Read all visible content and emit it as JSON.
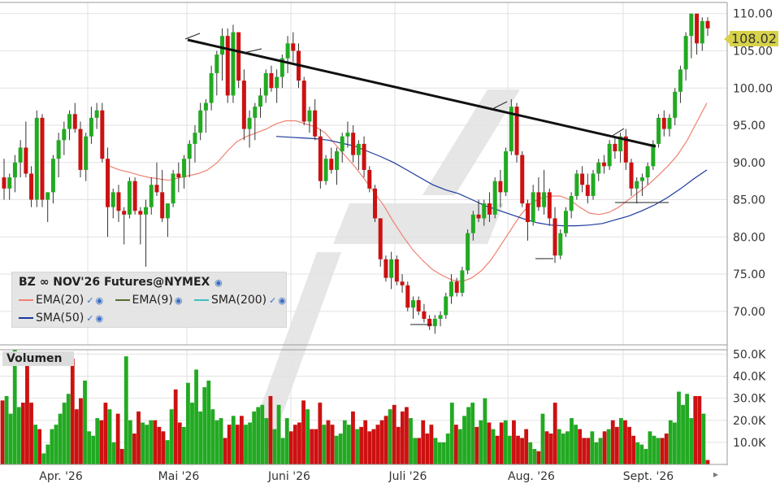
{
  "legend": {
    "title": "BZ ∞ NOV'26 Futures@NYMEX",
    "items": [
      {
        "name": "EMA(20)",
        "color": "#f08070"
      },
      {
        "name": "EMA(9)",
        "color": "#556b2f"
      },
      {
        "name": "SMA(200)",
        "color": "#40c0c0"
      },
      {
        "name": "SMA(50)",
        "color": "#1a3a9c"
      }
    ]
  },
  "volume_label": "Volumen",
  "last_price": "108.02",
  "chart_data": [
    {
      "type": "candlestick",
      "title": "BZ ∞ NOV'26 Futures@NYMEX",
      "y_ticks": [
        "70.00",
        "75.00",
        "80.00",
        "85.00",
        "90.00",
        "95.00",
        "100.00",
        "105.00",
        "110.00"
      ],
      "ylim": [
        65.5,
        111.5
      ],
      "x_tick_labels": [
        "Apr. '26",
        "Mai '26",
        "Juni '26",
        "Juli '26",
        "Aug. '26",
        "Sept. '26"
      ],
      "grid": true,
      "colors": {
        "up": "#22aa22",
        "down": "#cc1111"
      },
      "candles": [
        [
          88.0,
          90.5,
          85.0,
          86.5
        ],
        [
          86.5,
          88.5,
          85.0,
          88.0
        ],
        [
          88.0,
          91.0,
          86.0,
          90.0
        ],
        [
          90.0,
          93.0,
          88.0,
          92.0
        ],
        [
          92.0,
          95.5,
          88.0,
          88.5
        ],
        [
          88.5,
          89.5,
          84.0,
          85.0
        ],
        [
          85.0,
          97.0,
          84.0,
          96.0
        ],
        [
          96.0,
          96.5,
          84.0,
          85.0
        ],
        [
          85.0,
          86.0,
          82.0,
          86.0
        ],
        [
          86.0,
          91.0,
          84.5,
          90.5
        ],
        [
          90.5,
          94.0,
          88.0,
          93.0
        ],
        [
          93.0,
          95.5,
          91.0,
          94.5
        ],
        [
          94.5,
          97.0,
          93.0,
          96.5
        ],
        [
          96.5,
          98.0,
          94.0,
          94.5
        ],
        [
          94.5,
          95.5,
          88.0,
          89.0
        ],
        [
          89.0,
          94.0,
          87.5,
          93.5
        ],
        [
          93.5,
          97.5,
          92.5,
          96.0
        ],
        [
          96.0,
          98.0,
          94.5,
          97.0
        ],
        [
          97.0,
          98.0,
          90.0,
          90.5
        ],
        [
          90.5,
          92.0,
          80.0,
          84.0
        ],
        [
          84.0,
          86.5,
          82.5,
          86.0
        ],
        [
          86.0,
          87.0,
          82.0,
          83.5
        ],
        [
          83.5,
          84.0,
          79.0,
          83.0
        ],
        [
          83.0,
          88.0,
          82.5,
          87.5
        ],
        [
          87.5,
          88.0,
          83.0,
          83.5
        ],
        [
          83.5,
          84.0,
          79.0,
          83.0
        ],
        [
          83.0,
          85.0,
          76.0,
          84.0
        ],
        [
          84.0,
          88.0,
          83.0,
          87.0
        ],
        [
          87.0,
          90.0,
          85.5,
          86.0
        ],
        [
          86.0,
          89.0,
          82.0,
          82.5
        ],
        [
          82.5,
          84.0,
          80.0,
          84.5
        ],
        [
          84.5,
          89.0,
          84.0,
          88.5
        ],
        [
          88.5,
          90.0,
          86.0,
          88.0
        ],
        [
          88.0,
          91.0,
          86.5,
          90.5
        ],
        [
          90.5,
          93.0,
          88.0,
          92.5
        ],
        [
          92.5,
          95.0,
          90.0,
          94.0
        ],
        [
          94.0,
          98.0,
          93.0,
          97.0
        ],
        [
          97.0,
          98.5,
          94.0,
          98.0
        ],
        [
          98.0,
          103.0,
          97.0,
          102.0
        ],
        [
          102.0,
          105.0,
          99.0,
          104.5
        ],
        [
          104.5,
          108.0,
          101.0,
          107.0
        ],
        [
          107.0,
          108.0,
          98.0,
          99.0
        ],
        [
          99.0,
          108.5,
          98.0,
          107.5
        ],
        [
          107.5,
          107.5,
          100.0,
          101.0
        ],
        [
          101.0,
          102.5,
          93.0,
          94.5
        ],
        [
          94.5,
          97.0,
          92.0,
          96.0
        ],
        [
          96.0,
          98.0,
          93.0,
          97.5
        ],
        [
          97.5,
          100.0,
          96.0,
          99.0
        ],
        [
          99.0,
          102.5,
          98.0,
          102.0
        ],
        [
          102.0,
          103.0,
          99.5,
          100.0
        ],
        [
          100.0,
          102.5,
          98.0,
          101.5
        ],
        [
          101.5,
          104.5,
          100.0,
          104.0
        ],
        [
          104.0,
          107.0,
          102.0,
          106.0
        ],
        [
          106.0,
          107.5,
          103.5,
          105.0
        ],
        [
          105.0,
          106.0,
          100.0,
          101.0
        ],
        [
          101.0,
          101.5,
          95.0,
          95.5
        ],
        [
          95.5,
          97.5,
          94.0,
          97.0
        ],
        [
          97.0,
          98.5,
          93.0,
          93.5
        ],
        [
          93.5,
          94.5,
          86.5,
          87.5
        ],
        [
          87.5,
          91.0,
          87.0,
          90.5
        ],
        [
          90.5,
          92.0,
          88.5,
          89.0
        ],
        [
          89.0,
          92.0,
          87.0,
          91.5
        ],
        [
          91.5,
          94.0,
          90.0,
          93.5
        ],
        [
          93.5,
          95.5,
          92.0,
          94.0
        ],
        [
          94.0,
          95.0,
          90.0,
          91.0
        ],
        [
          91.0,
          93.0,
          89.0,
          92.5
        ],
        [
          92.5,
          93.5,
          88.0,
          89.0
        ],
        [
          89.0,
          89.5,
          86.0,
          86.5
        ],
        [
          86.5,
          87.0,
          82.0,
          82.5
        ],
        [
          82.5,
          82.5,
          76.0,
          77.0
        ],
        [
          77.0,
          77.5,
          74.0,
          74.5
        ],
        [
          74.5,
          78.0,
          73.0,
          77.0
        ],
        [
          77.0,
          77.5,
          73.5,
          74.0
        ],
        [
          74.0,
          75.0,
          72.5,
          73.5
        ],
        [
          73.5,
          74.0,
          70.0,
          70.5
        ],
        [
          70.5,
          72.0,
          69.0,
          71.5
        ],
        [
          71.5,
          72.0,
          69.5,
          70.0
        ],
        [
          70.0,
          71.0,
          68.5,
          69.0
        ],
        [
          69.0,
          69.5,
          67.5,
          68.0
        ],
        [
          68.0,
          69.5,
          67.0,
          69.0
        ],
        [
          69.0,
          70.0,
          68.0,
          69.5
        ],
        [
          69.5,
          72.5,
          69.0,
          72.0
        ],
        [
          72.0,
          75.0,
          71.0,
          74.0
        ],
        [
          74.0,
          74.5,
          72.0,
          72.5
        ],
        [
          72.5,
          76.0,
          72.0,
          75.5
        ],
        [
          75.5,
          81.0,
          75.0,
          80.5
        ],
        [
          80.5,
          83.5,
          79.5,
          83.0
        ],
        [
          83.0,
          85.0,
          82.0,
          82.5
        ],
        [
          82.5,
          85.0,
          81.5,
          84.5
        ],
        [
          84.5,
          86.0,
          82.0,
          83.0
        ],
        [
          83.0,
          88.0,
          82.5,
          87.5
        ],
        [
          87.5,
          89.0,
          84.0,
          86.0
        ],
        [
          86.0,
          92.0,
          85.5,
          91.5
        ],
        [
          91.5,
          98.5,
          91.0,
          97.5
        ],
        [
          97.5,
          98.0,
          90.0,
          91.0
        ],
        [
          91.0,
          91.5,
          84.0,
          84.5
        ],
        [
          84.5,
          85.0,
          79.5,
          82.0
        ],
        [
          82.0,
          87.0,
          81.5,
          86.0
        ],
        [
          86.0,
          88.0,
          83.5,
          84.0
        ],
        [
          84.0,
          89.0,
          83.0,
          86.0
        ],
        [
          86.0,
          86.5,
          81.5,
          82.5
        ],
        [
          82.5,
          84.0,
          76.5,
          77.5
        ],
        [
          77.5,
          81.0,
          77.0,
          80.5
        ],
        [
          80.5,
          84.0,
          80.0,
          83.5
        ],
        [
          83.5,
          86.0,
          82.5,
          85.5
        ],
        [
          85.5,
          89.0,
          85.0,
          88.5
        ],
        [
          88.5,
          89.5,
          86.0,
          87.0
        ],
        [
          87.0,
          88.5,
          84.5,
          85.5
        ],
        [
          85.5,
          89.0,
          85.0,
          88.5
        ],
        [
          88.5,
          90.5,
          87.5,
          90.0
        ],
        [
          90.0,
          91.0,
          88.5,
          89.5
        ],
        [
          89.5,
          93.0,
          89.0,
          92.5
        ],
        [
          92.5,
          93.5,
          90.5,
          91.5
        ],
        [
          91.5,
          94.0,
          90.0,
          93.5
        ],
        [
          93.5,
          94.5,
          89.0,
          90.0
        ],
        [
          90.0,
          90.5,
          85.5,
          86.5
        ],
        [
          86.5,
          88.0,
          84.5,
          87.5
        ],
        [
          87.5,
          88.5,
          85.5,
          88.0
        ],
        [
          88.0,
          90.0,
          87.0,
          89.5
        ],
        [
          89.5,
          93.0,
          89.0,
          92.5
        ],
        [
          92.5,
          96.5,
          92.0,
          96.0
        ],
        [
          96.0,
          97.0,
          93.5,
          94.5
        ],
        [
          94.5,
          96.5,
          93.5,
          96.0
        ],
        [
          96.0,
          100.0,
          95.0,
          99.5
        ],
        [
          99.5,
          103.0,
          98.0,
          102.5
        ],
        [
          102.5,
          107.5,
          101.0,
          107.0
        ],
        [
          107.0,
          110.0,
          104.0,
          110.0
        ],
        [
          110.0,
          110.0,
          104.5,
          106.0
        ],
        [
          106.0,
          109.5,
          105.0,
          109.0
        ],
        [
          109.0,
          109.5,
          107.0,
          108.02
        ]
      ],
      "ema20": [
        89.5,
        89.0,
        88.7,
        88.3,
        88.0,
        87.8,
        87.6,
        87.9,
        88.2,
        88.5,
        89.0,
        90.0,
        91.5,
        92.8,
        93.5,
        94.0,
        94.5,
        95.2,
        95.6,
        95.6,
        95.2,
        94.8,
        94.0,
        92.5,
        91.0,
        89.5,
        87.8,
        86.0,
        84.2,
        82.0,
        80.0,
        78.2,
        76.8,
        75.6,
        74.8,
        74.2,
        74.0,
        74.5,
        75.5,
        77.0,
        79.0,
        81.0,
        83.0,
        84.5,
        85.2,
        85.5,
        85.5,
        85.0,
        84.0,
        83.2,
        83.0,
        83.3,
        84.0,
        85.0,
        86.0,
        87.0,
        88.2,
        89.5,
        91.0,
        93.0,
        95.5,
        98.0
      ],
      "sma50": [
        93.5,
        93.4,
        93.3,
        93.2,
        93.0,
        92.6,
        92.2,
        91.5,
        90.8,
        90.0,
        89.0,
        88.0,
        87.0,
        86.3,
        85.8,
        85.0,
        84.2,
        83.6,
        83.0,
        82.4,
        81.9,
        81.6,
        81.5,
        81.5,
        81.6,
        81.8,
        82.3,
        82.8,
        83.5,
        84.3,
        85.3,
        86.5,
        87.8,
        89.0
      ]
    },
    {
      "type": "bar",
      "title": "Volumen",
      "y_ticks": [
        "10.0K",
        "20.0K",
        "30.0K",
        "40.0K",
        "50.0K"
      ],
      "ylim": [
        0,
        52
      ],
      "colors": {
        "up": "#22aa22",
        "down": "#cc1111"
      },
      "values": [
        29,
        31,
        23,
        52,
        26,
        28,
        49,
        28,
        18,
        16,
        5,
        9,
        16,
        18,
        23,
        28,
        32,
        48,
        25,
        30,
        38,
        15,
        13,
        21,
        20,
        28,
        25,
        10,
        23,
        7,
        49,
        20,
        14,
        24,
        19,
        18,
        20,
        20,
        17,
        15,
        11,
        25,
        34,
        19,
        17,
        37,
        28,
        43,
        24,
        35,
        38,
        25,
        20,
        21,
        12,
        18,
        22,
        18,
        22,
        18,
        19,
        24,
        26,
        27,
        21,
        31,
        16,
        27,
        12,
        21,
        15,
        18,
        19,
        29,
        25,
        16,
        16,
        28,
        18,
        20,
        18,
        13,
        14,
        20,
        18,
        24,
        16,
        17,
        20,
        15,
        16,
        18,
        20,
        22,
        25,
        27,
        17,
        24,
        26,
        21,
        12,
        12,
        20,
        14,
        18,
        12,
        10,
        10,
        14,
        28,
        18,
        16,
        22,
        26,
        28,
        17,
        20,
        30,
        19,
        16,
        13,
        19,
        20,
        13,
        20,
        13,
        12,
        16,
        10,
        7,
        6,
        23,
        15,
        14,
        28,
        16,
        14,
        15,
        21,
        18,
        16,
        12,
        12,
        15,
        10,
        12,
        15,
        16,
        20,
        17,
        21,
        20,
        17,
        13,
        10,
        9,
        7,
        15,
        13,
        12,
        12,
        14,
        20,
        19,
        33,
        27,
        32,
        21,
        31,
        31,
        23,
        2
      ]
    }
  ]
}
